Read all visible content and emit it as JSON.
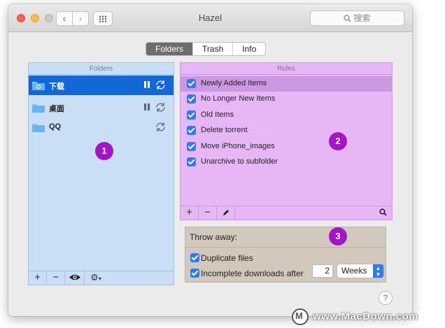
{
  "window": {
    "title": "Hazel",
    "search_placeholder": "搜索"
  },
  "toolbar": {
    "back_icon": "chevron-left-icon",
    "forward_icon": "chevron-right-icon",
    "grid_icon": "grid-icon"
  },
  "tabs": [
    {
      "label": "Folders",
      "active": true
    },
    {
      "label": "Trash",
      "active": false
    },
    {
      "label": "Info",
      "active": false
    }
  ],
  "folders": {
    "header": "Folders",
    "items": [
      {
        "name": "下载",
        "selected": true,
        "paused": true
      },
      {
        "name": "桌面",
        "selected": false,
        "paused": true
      },
      {
        "name": "QQ",
        "selected": false,
        "paused": false
      }
    ],
    "bottom_buttons": [
      "+",
      "−",
      "eye-icon",
      "gear-icon"
    ]
  },
  "rules": {
    "header": "Rules",
    "items": [
      {
        "label": "Newly Added Items",
        "checked": true,
        "selected": true
      },
      {
        "label": "No Longer New Items",
        "checked": true,
        "selected": false
      },
      {
        "label": "Old Items",
        "checked": true,
        "selected": false
      },
      {
        "label": "Delete torrent",
        "checked": true,
        "selected": false
      },
      {
        "label": "Move iPhone_images",
        "checked": true,
        "selected": false
      },
      {
        "label": "Unarchive to subfolder",
        "checked": true,
        "selected": false
      }
    ],
    "bottom_buttons": [
      "+",
      "−",
      "pencil-icon",
      "search-icon"
    ]
  },
  "throw_away": {
    "title": "Throw away:",
    "duplicate_label": "Duplicate files",
    "incomplete_label": "Incomplete downloads after",
    "incomplete_value": "2",
    "incomplete_unit": "Weeks"
  },
  "badges": [
    "1",
    "2",
    "3"
  ],
  "help_label": "?",
  "watermark": "www.MacDown.com",
  "colors": {
    "folders_bg": "#c9dff6",
    "rules_bg": "#e7b6f7",
    "throw_bg": "#d2c8bc",
    "badge": "#a414c9",
    "selection": "#1268d6",
    "checkbox": "#2c7bf0"
  }
}
